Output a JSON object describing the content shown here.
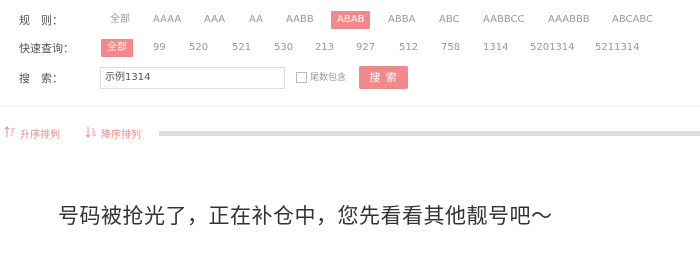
{
  "filters": {
    "rule": {
      "label": "规　则：",
      "options": [
        "全部",
        "AAAA",
        "AAA",
        "AA",
        "AABB",
        "ABAB",
        "ABBA",
        "ABC",
        "AABBCC",
        "AAABBB",
        "ABCABC"
      ],
      "active": "ABAB"
    },
    "quick": {
      "label": "快速查询：",
      "options": [
        "全部",
        "99",
        "520",
        "521",
        "530",
        "213",
        "927",
        "512",
        "758",
        "1314",
        "5201314",
        "5211314"
      ],
      "active": "全部"
    },
    "search": {
      "label": "搜　索：",
      "input_value": "示例1314",
      "checkbox_label": "尾数包含",
      "button_label": "搜 索"
    }
  },
  "sort": {
    "ascending": "升序排列",
    "descending": "降序排列"
  },
  "empty_message": "号码被抢光了，正在补仓中，您先看看其他靓号吧～",
  "colors": {
    "accent": "#f08a8a",
    "muted_text": "#999999",
    "label_text": "#555555"
  }
}
